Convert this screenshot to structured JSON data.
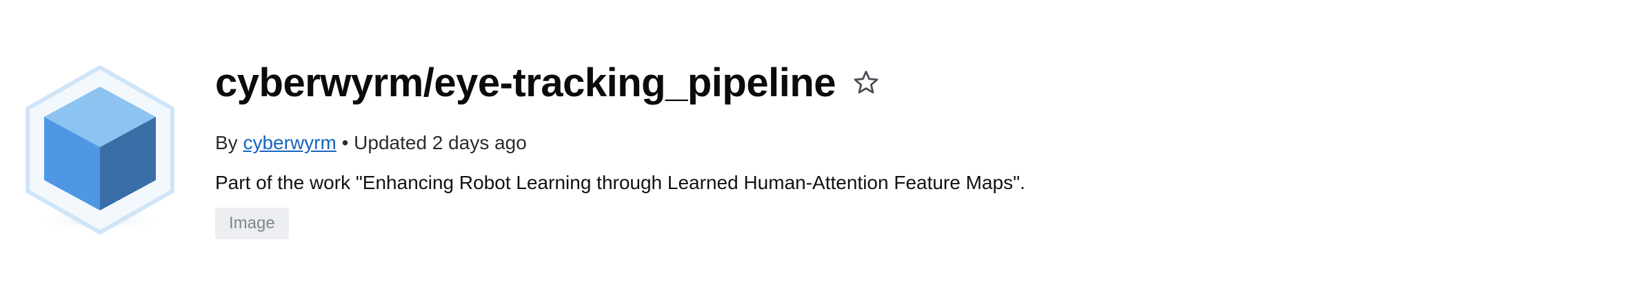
{
  "repo": {
    "title": "cyberwyrm/eye-tracking_pipeline",
    "by_prefix": "By",
    "author": "cyberwyrm",
    "updated": "• Updated 2 days ago",
    "description": "Part of the work \"Enhancing Robot Learning through Learned Human-Attention Feature Maps\".",
    "tags": [
      "Image"
    ]
  },
  "icons": {
    "logo": "cube-logo-icon",
    "star": "star-outline-icon"
  },
  "colors": {
    "link": "#1565c0",
    "cube_top": "#8cc3f1",
    "cube_left": "#4f97e3",
    "cube_right": "#3a6ea7",
    "hexagon": "#cfe4f7",
    "tag_bg": "#eceef1",
    "tag_text": "#7d8590"
  }
}
